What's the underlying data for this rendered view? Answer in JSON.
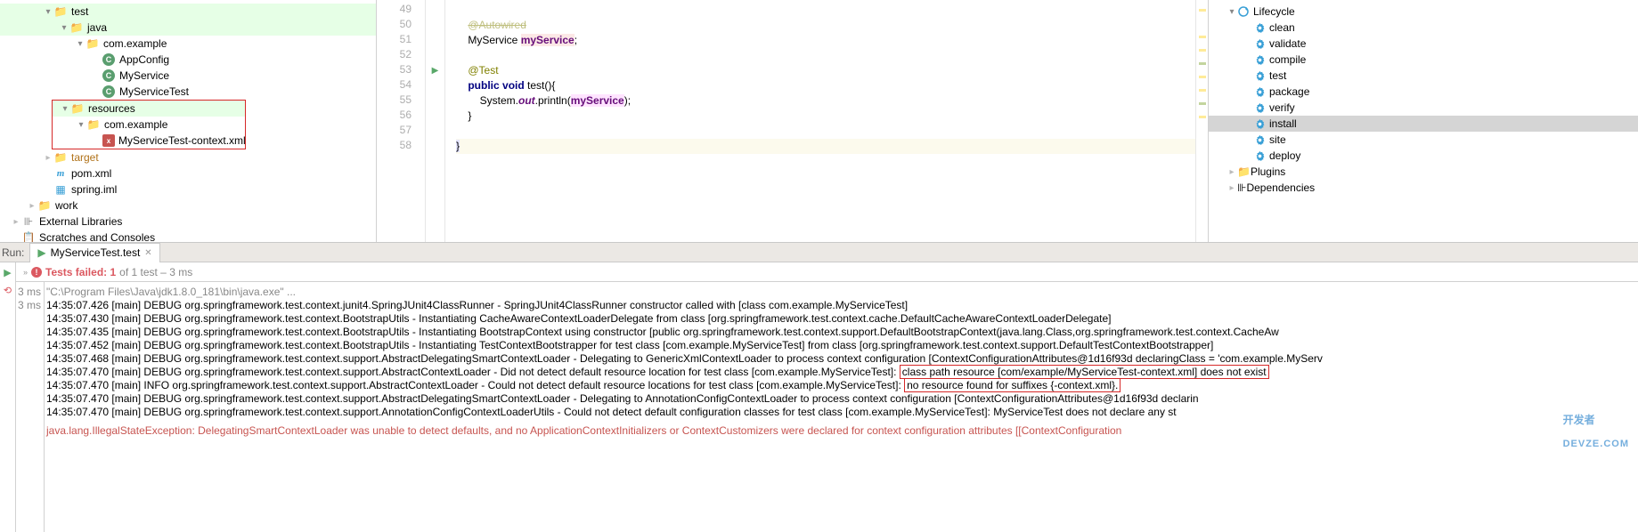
{
  "project_tree": {
    "test": "test",
    "java": "java",
    "com_example": "com.example",
    "AppConfig": "AppConfig",
    "MyService": "MyService",
    "MyServiceTest": "MyServiceTest",
    "resources": "resources",
    "com_example2": "com.example",
    "context_xml": "MyServiceTest-context.xml",
    "target": "target",
    "pom": "pom.xml",
    "spring_iml": "spring.iml",
    "work": "work",
    "ext_lib": "External Libraries",
    "scratches": "Scratches and Consoles"
  },
  "editor": {
    "lines": {
      "l49": "49",
      "l50": "50",
      "l51": "51",
      "l52": "52",
      "l53": "53",
      "l54": "54",
      "l55": "55",
      "l56": "56",
      "l57": "57",
      "l58": "58"
    },
    "code": {
      "autowired": "@Autowired",
      "myservice_type": "MyService ",
      "myservice_field": "myService",
      "semi": ";",
      "test_ann": "@Test",
      "public": "public",
      "void": " void ",
      "test_method": "test(){",
      "sysout_start": "        System.",
      "out": "out",
      "println": ".println(",
      "myservice_ref": "myService",
      "close_paren": ");",
      "close_brace": "    }",
      "final_brace": "}"
    }
  },
  "maven": {
    "lifecycle": "Lifecycle",
    "clean": "clean",
    "validate": "validate",
    "compile": "compile",
    "test": "test",
    "package": "package",
    "verify": "verify",
    "install": "install",
    "site": "site",
    "deploy": "deploy",
    "plugins": "Plugins",
    "dependencies": "Dependencies"
  },
  "run": {
    "label": "Run:",
    "tab_name": "MyServiceTest.test",
    "status_fail": "Tests failed: 1",
    "status_rest": " of 1 test – 3 ms",
    "time1": "3 ms",
    "time2": "3 ms",
    "cmd": "\"C:\\Program Files\\Java\\jdk1.8.0_181\\bin\\java.exe\" ...",
    "l1": "14:35:07.426 [main] DEBUG org.springframework.test.context.junit4.SpringJUnit4ClassRunner - SpringJUnit4ClassRunner constructor called with [class com.example.MyServiceTest]",
    "l2": "14:35:07.430 [main] DEBUG org.springframework.test.context.BootstrapUtils - Instantiating CacheAwareContextLoaderDelegate from class [org.springframework.test.context.cache.DefaultCacheAwareContextLoaderDelegate]",
    "l3": "14:35:07.435 [main] DEBUG org.springframework.test.context.BootstrapUtils - Instantiating BootstrapContext using constructor [public org.springframework.test.context.support.DefaultBootstrapContext(java.lang.Class,org.springframework.test.context.CacheAw",
    "l4": "14:35:07.452 [main] DEBUG org.springframework.test.context.BootstrapUtils - Instantiating TestContextBootstrapper for test class [com.example.MyServiceTest] from class [org.springframework.test.context.support.DefaultTestContextBootstrapper]",
    "l5": "14:35:07.468 [main] DEBUG org.springframework.test.context.support.AbstractDelegatingSmartContextLoader - Delegating to GenericXmlContextLoader to process context configuration [ContextConfigurationAttributes@1d16f93d declaringClass = 'com.example.MyServ",
    "l6a": "14:35:07.470 [main] DEBUG org.springframework.test.context.support.AbstractContextLoader - Did not detect default resource location for test class [com.example.MyServiceTest]: ",
    "l6b": "class path resource [com/example/MyServiceTest-context.xml] does not exist",
    "l7a": "14:35:07.470 [main] INFO org.springframework.test.context.support.AbstractContextLoader - Could not detect default resource locations for test class [com.example.MyServiceTest]: ",
    "l7b": "no resource found for suffixes {-context.xml}.",
    "l8": "14:35:07.470 [main] DEBUG org.springframework.test.context.support.AbstractDelegatingSmartContextLoader - Delegating to AnnotationConfigContextLoader to process context configuration [ContextConfigurationAttributes@1d16f93d declarin",
    "l9": "14:35:07.470 [main] DEBUG org.springframework.test.context.support.AnnotationConfigContextLoaderUtils - Could not detect default configuration classes for test class [com.example.MyServiceTest]: MyServiceTest does not declare any st",
    "l10": "java.lang.IllegalStateException: DelegatingSmartContextLoader was unable to detect defaults, and no ApplicationContextInitializers or ContextCustomizers were declared for context configuration attributes [[ContextConfiguration"
  },
  "watermark": "开发者 DEVZE.COM"
}
